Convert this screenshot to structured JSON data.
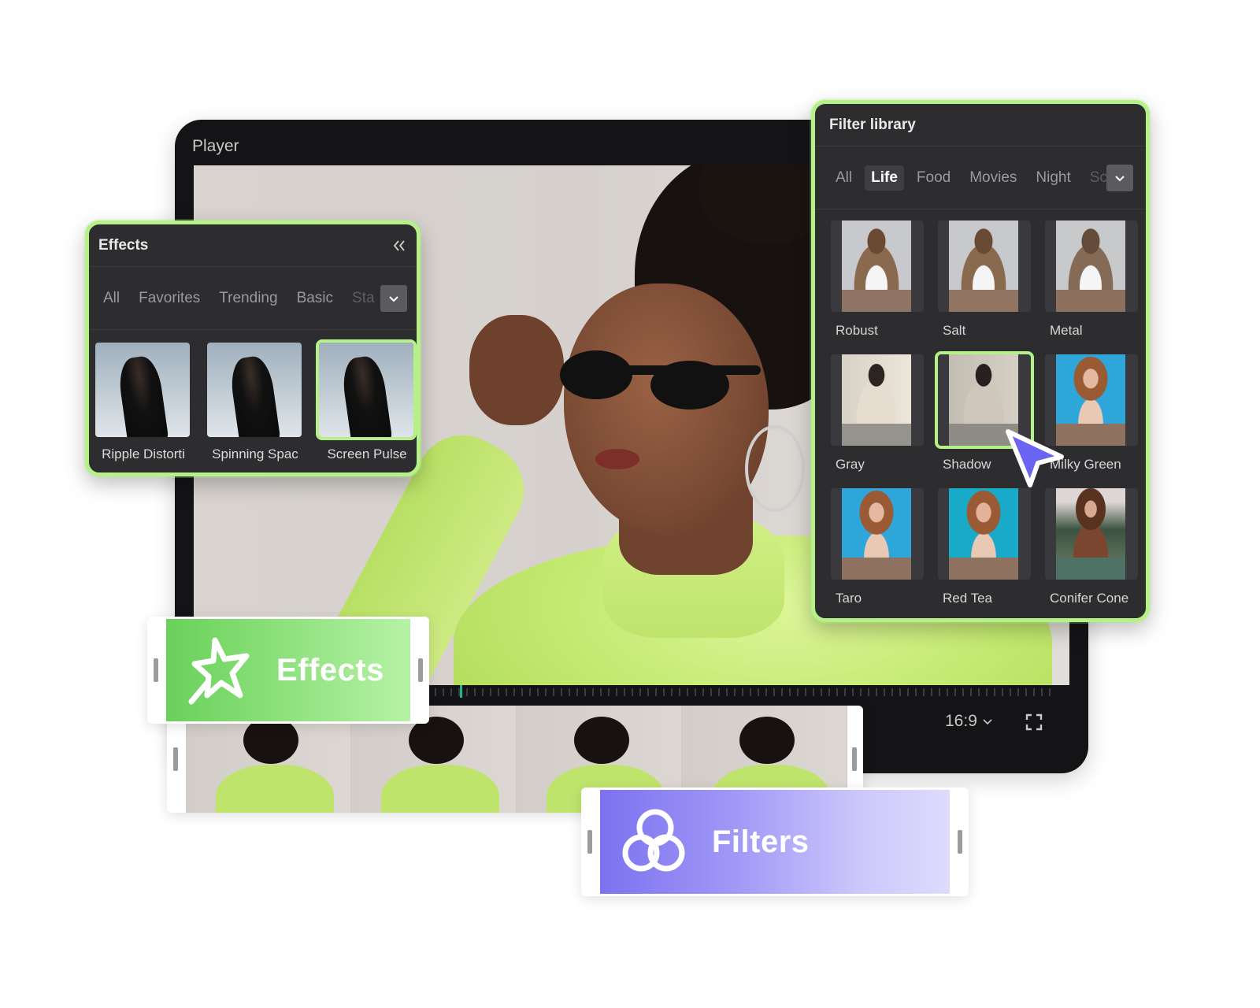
{
  "player": {
    "title": "Player",
    "aspect_ratio": "16:9",
    "aspect_ratio_icon": "chevron-down-icon",
    "fullscreen_icon": "fullscreen-icon"
  },
  "effects_panel": {
    "title": "Effects",
    "collapse_icon": "double-chevron-left-icon",
    "tabs": [
      {
        "label": "All",
        "active": false
      },
      {
        "label": "Favorites",
        "active": false
      },
      {
        "label": "Trending",
        "active": false
      },
      {
        "label": "Basic",
        "active": false
      },
      {
        "label": "Sta",
        "active": false
      }
    ],
    "items": [
      {
        "label": "Ripple Distorti",
        "selected": false
      },
      {
        "label": "Spinning Spac",
        "selected": false
      },
      {
        "label": "Screen Pulse",
        "selected": true
      }
    ]
  },
  "filter_panel": {
    "title": "Filter library",
    "tabs": [
      {
        "label": "All",
        "active": false
      },
      {
        "label": "Life",
        "active": true
      },
      {
        "label": "Food",
        "active": false
      },
      {
        "label": "Movies",
        "active": false
      },
      {
        "label": "Night",
        "active": false
      },
      {
        "label": "Sc",
        "active": false
      }
    ],
    "items": [
      {
        "label": "Robust",
        "selected": false
      },
      {
        "label": "Salt",
        "selected": false
      },
      {
        "label": "Metal",
        "selected": false
      },
      {
        "label": "Gray",
        "selected": false
      },
      {
        "label": "Shadow",
        "selected": true
      },
      {
        "label": "Milky Green",
        "selected": false
      },
      {
        "label": "Taro",
        "selected": false
      },
      {
        "label": "Red Tea",
        "selected": false
      },
      {
        "label": "Conifer Cone",
        "selected": false
      }
    ]
  },
  "clips": {
    "effects_label": "Effects",
    "filters_label": "Filters"
  },
  "colors": {
    "accent_green": "#b5f088",
    "accent_purple": "#7c72f0",
    "panel_bg": "#2d2d30",
    "player_bg": "#141316"
  }
}
